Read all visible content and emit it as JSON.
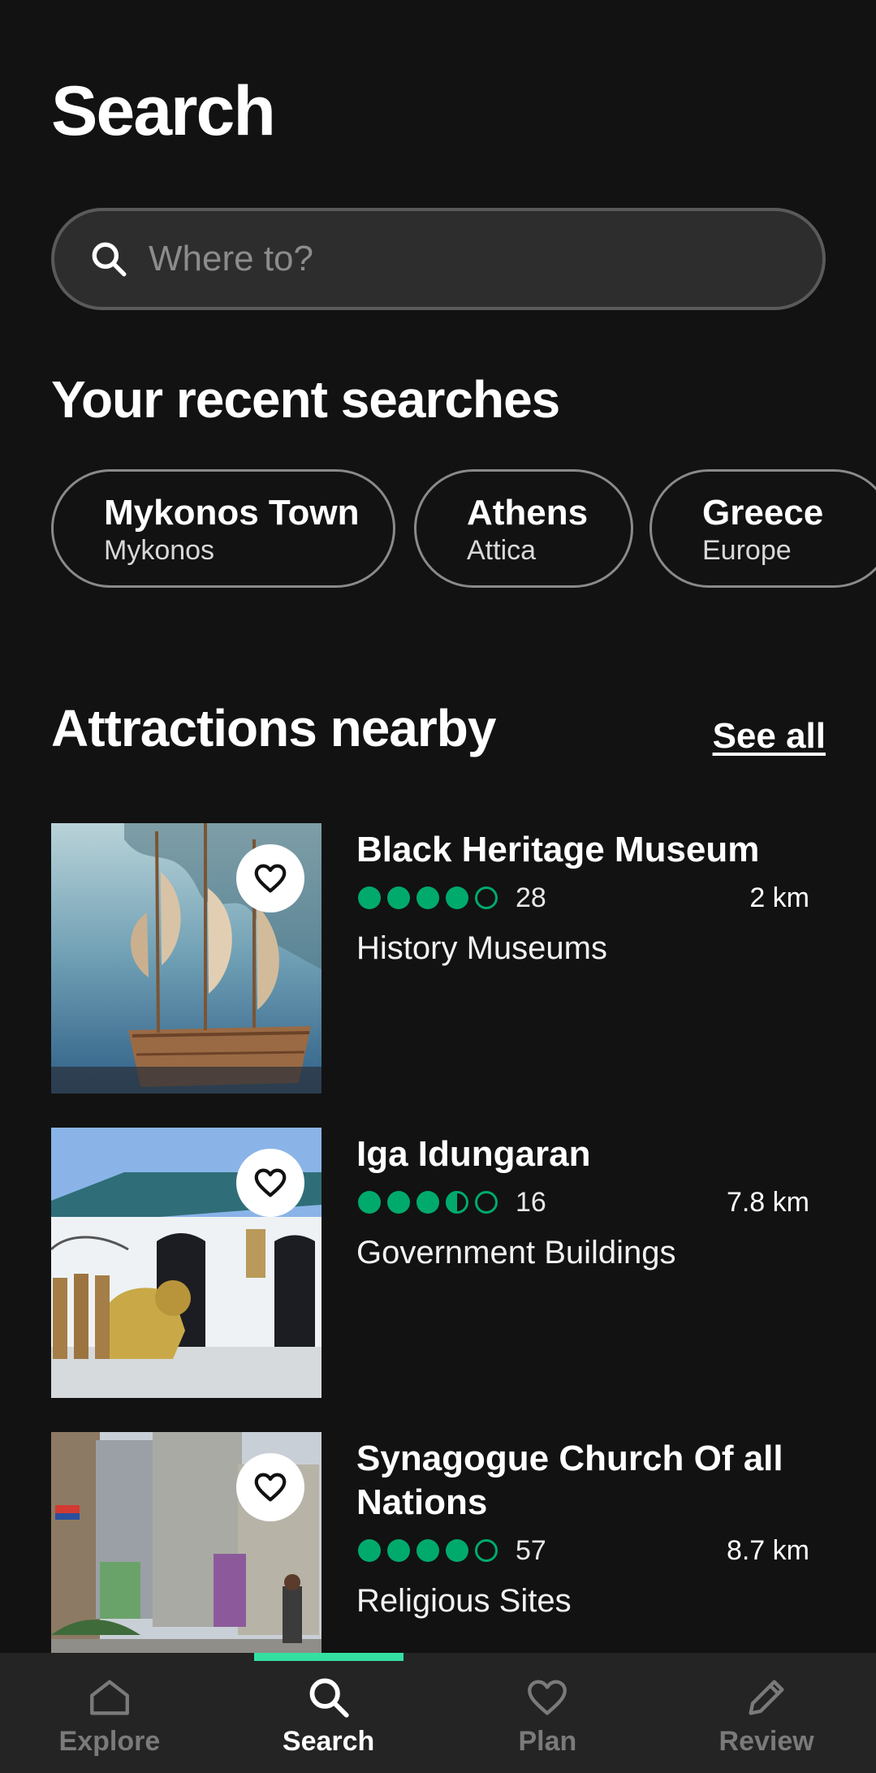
{
  "header": {
    "title": "Search"
  },
  "search": {
    "placeholder": "Where to?"
  },
  "recent": {
    "title": "Your recent searches",
    "items": [
      {
        "name": "Mykonos Town",
        "sub": "Mykonos"
      },
      {
        "name": "Athens",
        "sub": "Attica"
      },
      {
        "name": "Greece",
        "sub": "Europe"
      }
    ]
  },
  "nearby": {
    "title": "Attractions nearby",
    "see_all": "See all",
    "items": [
      {
        "name": "Black Heritage Museum",
        "rating": 4,
        "reviews": "28",
        "distance": "2 km",
        "category": "History Museums"
      },
      {
        "name": "Iga Idungaran",
        "rating": 3.5,
        "reviews": "16",
        "distance": "7.8 km",
        "category": "Government Buildings"
      },
      {
        "name": "Synagogue Church Of all Nations",
        "rating": 4,
        "reviews": "57",
        "distance": "8.7 km",
        "category": "Religious Sites"
      }
    ]
  },
  "nav": {
    "items": [
      {
        "label": "Explore",
        "icon": "home-icon"
      },
      {
        "label": "Search",
        "icon": "search-icon",
        "active": true
      },
      {
        "label": "Plan",
        "icon": "heart-icon"
      },
      {
        "label": "Review",
        "icon": "pencil-icon"
      }
    ]
  },
  "colors": {
    "accent": "#34e0a1",
    "rating": "#00aa6c",
    "background": "#121212"
  }
}
